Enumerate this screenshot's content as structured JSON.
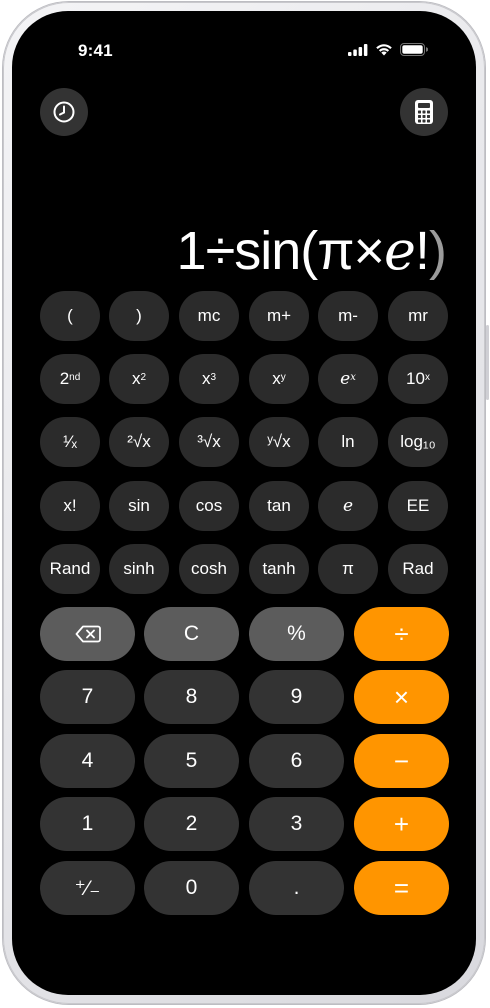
{
  "status_bar": {
    "time": "9:41"
  },
  "display": {
    "expression": "1÷sin(π×",
    "ital_e": "e",
    "bang": "!",
    "close_paren": ")"
  },
  "top_buttons": [
    {
      "icon": "history-clock-icon"
    },
    {
      "icon": "calculator-mode-icon"
    }
  ],
  "scientific_rows": [
    [
      {
        "label": "("
      },
      {
        "label": ")"
      },
      {
        "label": "mc"
      },
      {
        "label": "m+"
      },
      {
        "label": "m-"
      },
      {
        "label": "mr"
      }
    ],
    [
      {
        "label": "2",
        "sup": "nd"
      },
      {
        "label": "x",
        "sup": "2"
      },
      {
        "label": "x",
        "sup": "3"
      },
      {
        "label": "x",
        "sup": "y"
      },
      {
        "label": "e",
        "sup": "x",
        "italic": true
      },
      {
        "label": "10",
        "sup": "x"
      }
    ],
    [
      {
        "label": "¹⁄ₓ"
      },
      {
        "label": "²√x"
      },
      {
        "label": "³√x"
      },
      {
        "label": "ʸ√x"
      },
      {
        "label": "ln"
      },
      {
        "label": "log₁₀"
      }
    ],
    [
      {
        "label": "x!"
      },
      {
        "label": "sin"
      },
      {
        "label": "cos"
      },
      {
        "label": "tan"
      },
      {
        "label": "e",
        "italic": true
      },
      {
        "label": "EE"
      }
    ],
    [
      {
        "label": "Rand"
      },
      {
        "label": "sinh"
      },
      {
        "label": "cosh"
      },
      {
        "label": "tanh"
      },
      {
        "label": "π"
      },
      {
        "label": "Rad"
      }
    ]
  ],
  "main_rows": [
    [
      {
        "label": "",
        "icon": "backspace-icon",
        "kind": "fn"
      },
      {
        "label": "C",
        "kind": "fn"
      },
      {
        "label": "%",
        "kind": "fn"
      },
      {
        "label": "÷",
        "kind": "op"
      }
    ],
    [
      {
        "label": "7",
        "kind": "num"
      },
      {
        "label": "8",
        "kind": "num"
      },
      {
        "label": "9",
        "kind": "num"
      },
      {
        "label": "×",
        "kind": "op"
      }
    ],
    [
      {
        "label": "4",
        "kind": "num"
      },
      {
        "label": "5",
        "kind": "num"
      },
      {
        "label": "6",
        "kind": "num"
      },
      {
        "label": "−",
        "kind": "op"
      }
    ],
    [
      {
        "label": "1",
        "kind": "num"
      },
      {
        "label": "2",
        "kind": "num"
      },
      {
        "label": "3",
        "kind": "num"
      },
      {
        "label": "+",
        "kind": "op"
      }
    ],
    [
      {
        "label": "⁺⁄₋",
        "kind": "num"
      },
      {
        "label": "0",
        "kind": "num"
      },
      {
        "label": ".",
        "kind": "num"
      },
      {
        "label": "=",
        "kind": "op"
      }
    ]
  ],
  "colors": {
    "operator": "#ff9500",
    "number_key": "#333333",
    "function_key": "#5c5c5c",
    "scientific_key": "#2b2b2b",
    "background": "#000000"
  }
}
